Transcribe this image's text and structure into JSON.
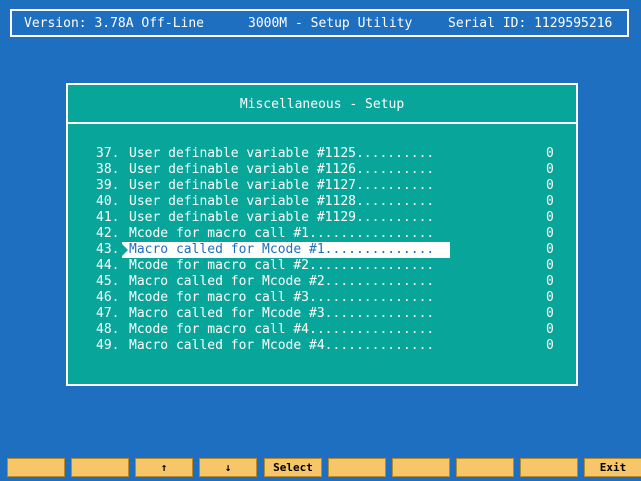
{
  "header": {
    "version": "Version: 3.78A Off-Line",
    "title": "3000M - Setup Utility",
    "serial": "Serial ID: 1129595216"
  },
  "dialog": {
    "title": "Miscellaneous - Setup",
    "items": [
      {
        "num": "37.",
        "label": "User definable variable #1125..........",
        "value": "0"
      },
      {
        "num": "38.",
        "label": "User definable variable #1126..........",
        "value": "0"
      },
      {
        "num": "39.",
        "label": "User definable variable #1127..........",
        "value": "0"
      },
      {
        "num": "40.",
        "label": "User definable variable #1128..........",
        "value": "0"
      },
      {
        "num": "41.",
        "label": "User definable variable #1129..........",
        "value": "0"
      },
      {
        "num": "42.",
        "label": "Mcode for macro call #1................",
        "value": "0"
      },
      {
        "num": "43.",
        "label": "Macro called for Mcode #1..............",
        "value": "0"
      },
      {
        "num": "44.",
        "label": "Mcode for macro call #2................",
        "value": "0"
      },
      {
        "num": "45.",
        "label": "Macro called for Mcode #2..............",
        "value": "0"
      },
      {
        "num": "46.",
        "label": "Mcode for macro call #3................",
        "value": "0"
      },
      {
        "num": "47.",
        "label": "Macro called for Mcode #3..............",
        "value": "0"
      },
      {
        "num": "48.",
        "label": "Mcode for macro call #4................",
        "value": "0"
      },
      {
        "num": "49.",
        "label": "Macro called for Mcode #4..............",
        "value": "0"
      }
    ],
    "selected_number": "43."
  },
  "function_keys": [
    "",
    "",
    "↑",
    "↓",
    "Select",
    "",
    "",
    "",
    "",
    "Exit"
  ],
  "colors": {
    "background": "#1e6fbf",
    "dialog": "#08a59a",
    "function_key": "#f6c668",
    "highlight": "#ffffff"
  }
}
